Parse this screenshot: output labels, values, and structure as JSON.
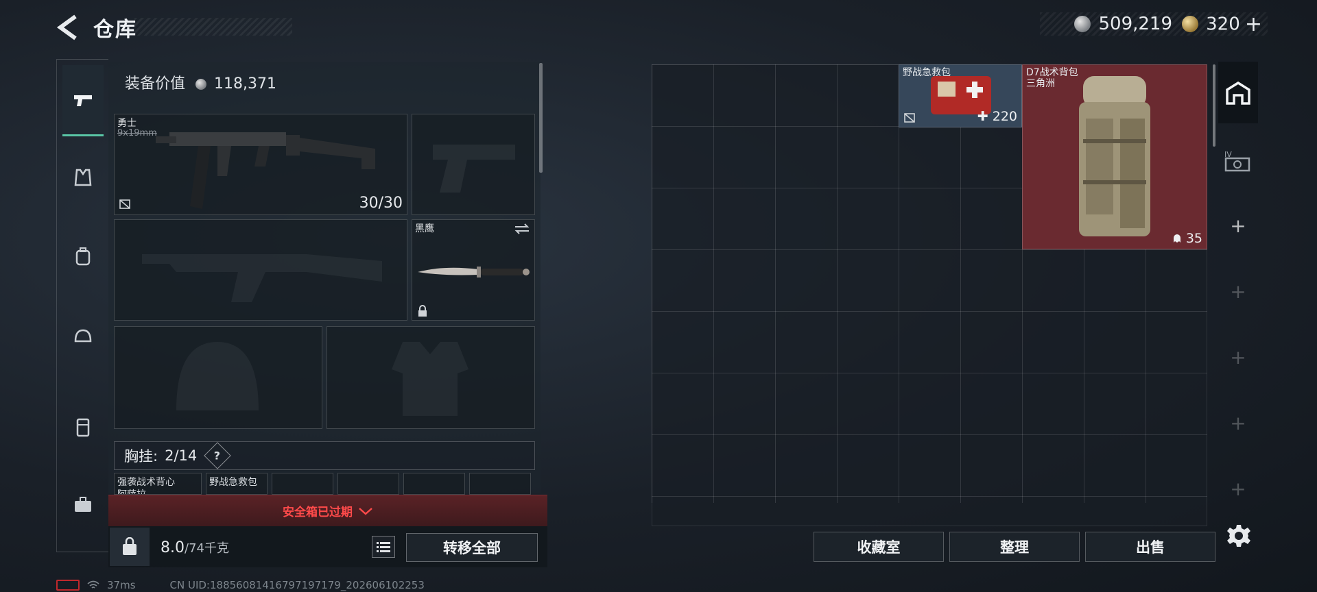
{
  "header": {
    "title": "仓库",
    "currency": [
      {
        "icon": "silver-coin-icon",
        "value": "509,219"
      },
      {
        "icon": "gold-coin-icon",
        "value": "320",
        "suffix": "+"
      }
    ]
  },
  "equipment": {
    "value_label": "装备价值",
    "value": "118,371",
    "primary_weapon": {
      "name": "勇士",
      "ammo": "9x19mm",
      "count": "30/30"
    },
    "melee": {
      "name": "黑鹰"
    },
    "chest_rig": {
      "label": "胸挂:",
      "capacity": "2/14",
      "help": "?"
    },
    "chest_items": [
      "强袭战术背心",
      "野战急救包",
      "",
      "",
      "",
      ""
    ],
    "chest_item_sub": "阿萨拉"
  },
  "safe_box": {
    "text": "安全箱已过期"
  },
  "weight": {
    "current": "8.0",
    "max": "/74千克"
  },
  "transfer_all_label": "转移全部",
  "warehouse": {
    "items": [
      {
        "name": "野战急救包",
        "count": "220",
        "count_icon": "plus-icon"
      },
      {
        "name": "D7战术背包",
        "sub": "三角洲",
        "count": "35",
        "count_icon": "ghost-icon"
      }
    ],
    "buttons": {
      "collection": "收藏室",
      "organize": "整理",
      "sell": "出售"
    }
  },
  "status": {
    "ping": "37ms",
    "uid": "CN UID:18856081416797197179_202606102253"
  },
  "colors": {
    "accent": "#5ac6a6",
    "warning_red": "#ff4a4a",
    "backpack_bg": "#6a2a30",
    "medkit_bg": "#3a4a5c"
  }
}
